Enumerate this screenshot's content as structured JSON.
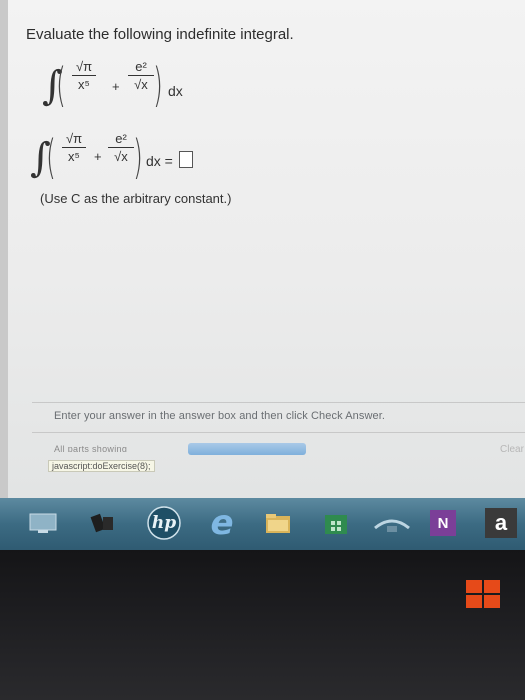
{
  "problem": {
    "title": "Evaluate the following indefinite integral.",
    "expr1": {
      "integral": "∫",
      "term1_num": "√π",
      "term1_den": "x⁵",
      "plus": "+",
      "term2_num": "e²",
      "term2_den": "√x",
      "dx": "dx"
    },
    "expr2": {
      "integral": "∫",
      "term1_num": "√π",
      "term1_den": "x⁵",
      "plus": "+",
      "term2_num": "e²",
      "term2_den": "√x",
      "dx_equals": "dx ="
    },
    "note": "(Use C as the arbitrary constant.)"
  },
  "footer": {
    "instructions": "Enter your answer in the answer box and then click Check Answer.",
    "parts_label": "All parts showing",
    "clear_label": "Clear A",
    "status_url": "javascript:doExercise(8);"
  },
  "taskbar": {
    "hp_label": "hp",
    "ie_label": "e",
    "onenote_label": "N",
    "amazon_label": "a"
  },
  "colors": {
    "taskbar": "#3c6b83",
    "progress": "#7fb0dc",
    "windows_logo": "#e64a19"
  }
}
